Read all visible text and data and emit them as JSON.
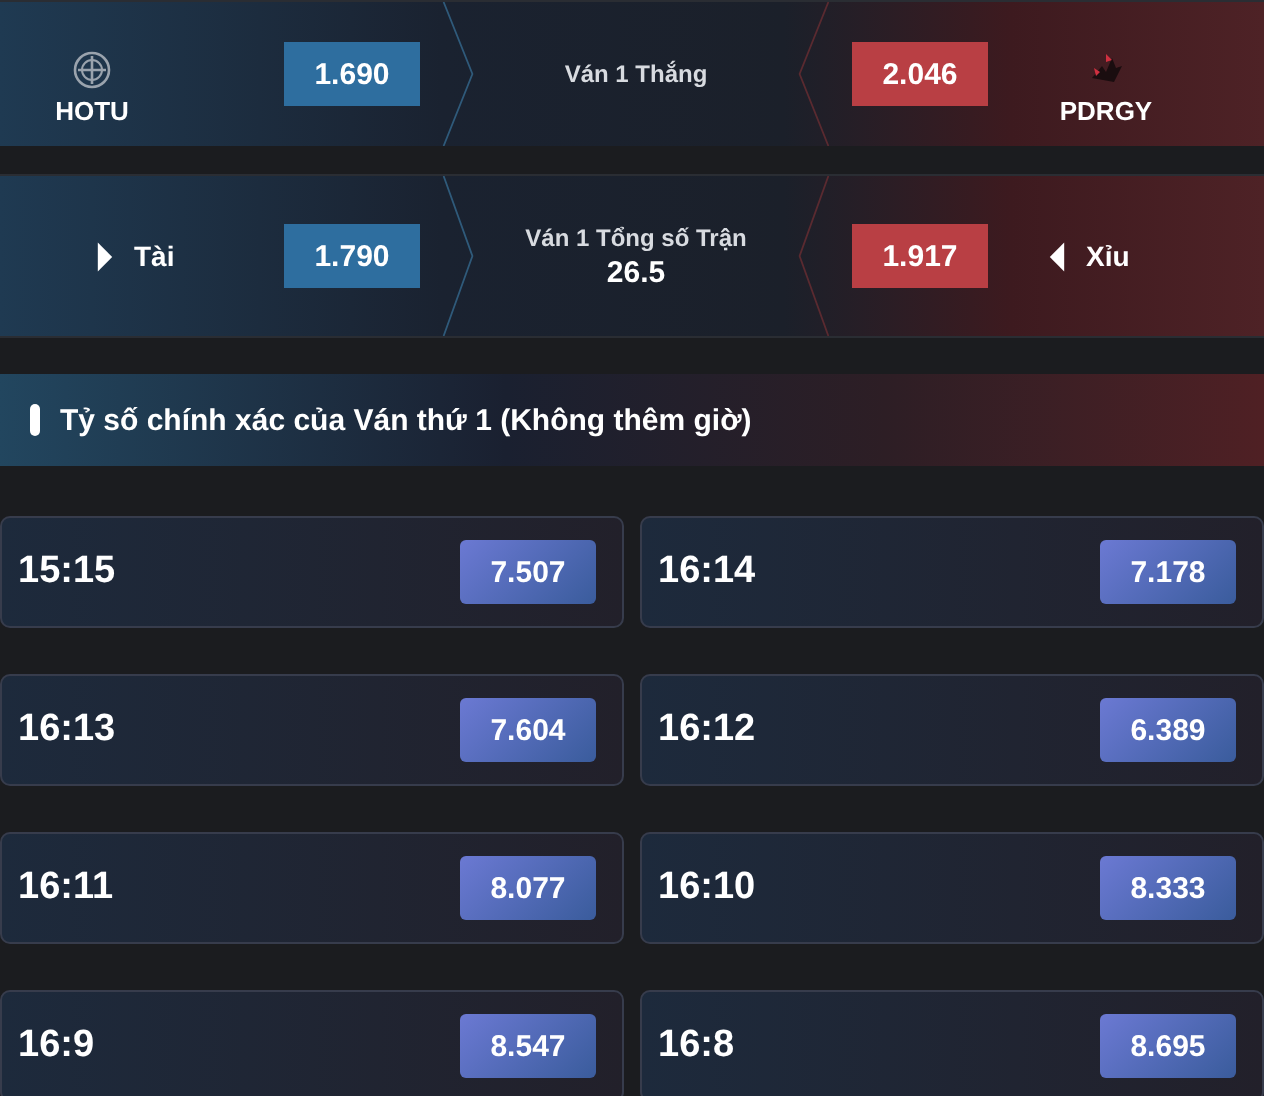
{
  "match_winner": {
    "title": "Ván 1 Thắng",
    "home": {
      "name": "HOTU",
      "odds": "1.690"
    },
    "away": {
      "name": "PDRGY",
      "odds": "2.046"
    }
  },
  "total": {
    "title": "Ván 1 Tổng số Trận",
    "line": "26.5",
    "over": {
      "label": "Tài",
      "odds": "1.790"
    },
    "under": {
      "label": "Xỉu",
      "odds": "1.917"
    }
  },
  "correct_score": {
    "title": "Tỷ số chính xác của Ván thứ 1 (Không thêm giờ)",
    "options": [
      {
        "score": "15:15",
        "odds": "7.507"
      },
      {
        "score": "16:14",
        "odds": "7.178"
      },
      {
        "score": "16:13",
        "odds": "7.604"
      },
      {
        "score": "16:12",
        "odds": "6.389"
      },
      {
        "score": "16:11",
        "odds": "8.077"
      },
      {
        "score": "16:10",
        "odds": "8.333"
      },
      {
        "score": "16:9",
        "odds": "8.547"
      },
      {
        "score": "16:8",
        "odds": "8.695"
      }
    ]
  }
}
